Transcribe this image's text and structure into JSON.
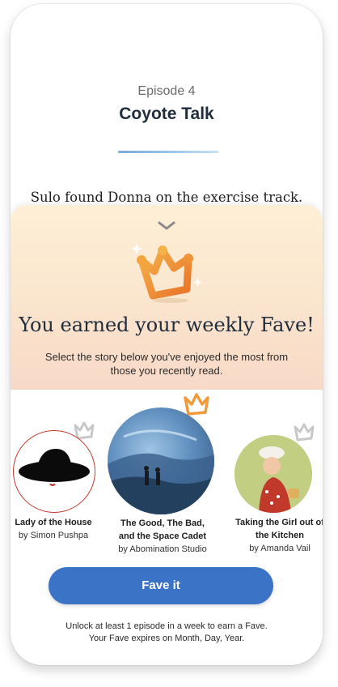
{
  "episode": {
    "number_label": "Episode 4",
    "title": "Coyote Talk",
    "story_text": "Sulo found Donna on the exercise track."
  },
  "fave_sheet": {
    "heading": "You earned your weekly Fave!",
    "description": "Select the story below you've enjoyed the most from those you recently read.",
    "stories": [
      {
        "title": "Lady of the House",
        "author": "by Simon Pushpa",
        "selected": false
      },
      {
        "title": "The Good, The Bad, and the Space Cadet",
        "author": "by Abomination Studio",
        "selected": true
      },
      {
        "title": "Taking the Girl out of the Kitchen",
        "author": "by Amanda Vail",
        "selected": false
      }
    ],
    "button_label": "Fave it",
    "footer_line1": "Unlock at least 1 episode in a week to earn a Fave.",
    "footer_line2": "Your Fave expires on Month, Day, Year."
  },
  "icons": {
    "chevron": "chevron-down-icon",
    "crown_large": "crown-icon",
    "crown_selected": "crown-orange-icon",
    "crown_unselected": "crown-gray-icon"
  },
  "colors": {
    "accent_blue": "#3b73c6",
    "crown_orange": "#f09a3a",
    "crown_gray": "#c8c8c8"
  }
}
